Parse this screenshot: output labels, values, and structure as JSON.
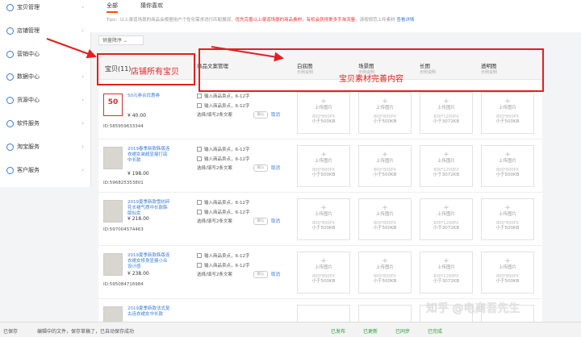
{
  "sidebar": {
    "items": [
      {
        "label": "宝贝管理"
      },
      {
        "label": "店铺管理"
      },
      {
        "label": "营销中心"
      },
      {
        "label": "数据中心"
      },
      {
        "label": "货源中心"
      },
      {
        "label": "软件服务"
      },
      {
        "label": "淘宝服务"
      },
      {
        "label": "客户服务"
      }
    ]
  },
  "tabs": [
    {
      "label": "全部"
    },
    {
      "label": "猜你喜欢"
    }
  ],
  "tips": {
    "prefix": "Tips：以上渠道场景的商品会根据用户个性化需求进行匹配展现，",
    "highlight": "优先完善以上渠道场景的商品素材，有机会获得更多手淘流量",
    "suffix": "，请按规范上传素材",
    "link": "查看详情"
  },
  "sort": {
    "label": "销量降序"
  },
  "table": {
    "headers": {
      "product": "宝贝(11)",
      "copy": "商品文案管理",
      "white": "白底图",
      "scene": "场景图",
      "long": "长图",
      "transparent": "透明图"
    },
    "example_label": "示例说明"
  },
  "upload": {
    "label": "上传图片",
    "square_spec": "800*800PX",
    "square_size": "小于500KB",
    "long_spec": "800*1200PX",
    "long_size": "小于3072KB"
  },
  "copy_editor": {
    "placeholder": "输入商品卖点，6-12字",
    "select_label": "选择/填写2条文案",
    "button": "确认",
    "cancel": "取消"
  },
  "products": [
    {
      "name": "50元券合优惠券",
      "price": "¥ 40.00",
      "id": "ID:585959633344"
    },
    {
      "name": "2019春季新款韩版连衣裙女装超显瘦打底中长款",
      "price": "¥ 198.00",
      "id": "ID:596825353801"
    },
    {
      "name": "2019夏季新款雪纺碎花长裙气质中长款韩版仙女",
      "price": "¥ 218.00",
      "id": "ID:597004574463"
    },
    {
      "name": "2019夏季新款韩版连衣裙女修身显瘦小众设计感",
      "price": "¥ 238.00",
      "id": "ID:595084716984"
    },
    {
      "name": "2019夏季新款法式复古连衣裙女中长款",
      "price": "",
      "id": ""
    }
  ],
  "annotations": {
    "left": "店铺所有宝贝",
    "right": "宝贝素材完善内容"
  },
  "statusbar": {
    "left": "已保存",
    "middle": "编辑中的文件，保存草稿了，已自动保存成功",
    "right1": "已发布",
    "right2": "已更新",
    "right3": "已同步",
    "right4": "已完成"
  },
  "watermark": "知乎 @电商吾先生"
}
